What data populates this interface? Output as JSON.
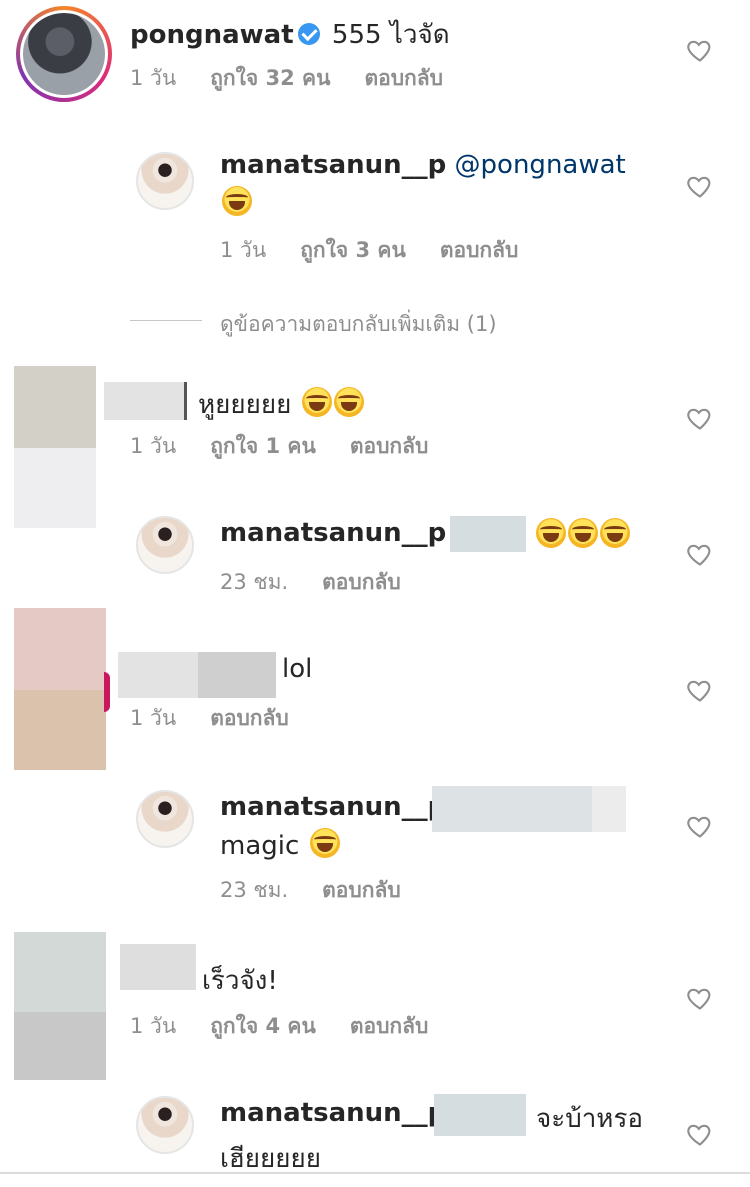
{
  "comments": [
    {
      "username": "pongnawat",
      "verified": true,
      "text": "555 ไวจัด",
      "time": "1 วัน",
      "likes": "ถูกใจ 32 คน",
      "reply": "ตอบกลับ"
    },
    {
      "username": "manatsanun__p",
      "mention": "@pongnawat",
      "time": "1 วัน",
      "likes": "ถูกใจ 3 คน",
      "reply": "ตอบกลับ"
    },
    {
      "view_more": "ดูข้อความตอบกลับเพิ่มเติม (1)"
    },
    {
      "text": "หูยยยยย",
      "time": "1 วัน",
      "likes": "ถูกใจ 1 คน",
      "reply": "ตอบกลับ"
    },
    {
      "username": "manatsanun__p",
      "mention_prefix": "@",
      "time": "23 ชม.",
      "reply": "ตอบกลับ"
    },
    {
      "text": "lol",
      "time": "1 วัน",
      "reply": "ตอบกลับ"
    },
    {
      "username": "manatsanun__p",
      "text": "magic",
      "time": "23 ชม.",
      "reply": "ตอบกลับ"
    },
    {
      "text": "เร็วจัง!",
      "time": "1 วัน",
      "likes": "ถูกใจ 4 คน",
      "reply": "ตอบกลับ"
    },
    {
      "username": "manatsanun__p",
      "mention_prefix": "@",
      "mention_tail": "จะบ้าหรอ",
      "text_line2": "เฮียยยยย"
    }
  ],
  "colors": {
    "text": "#262626",
    "meta": "#8e8e8e",
    "mention": "#00376b",
    "verified": "#3897f0"
  },
  "icons": [
    "heart-outline-icon",
    "verified-badge-icon",
    "laughing-emoji-icon"
  ]
}
